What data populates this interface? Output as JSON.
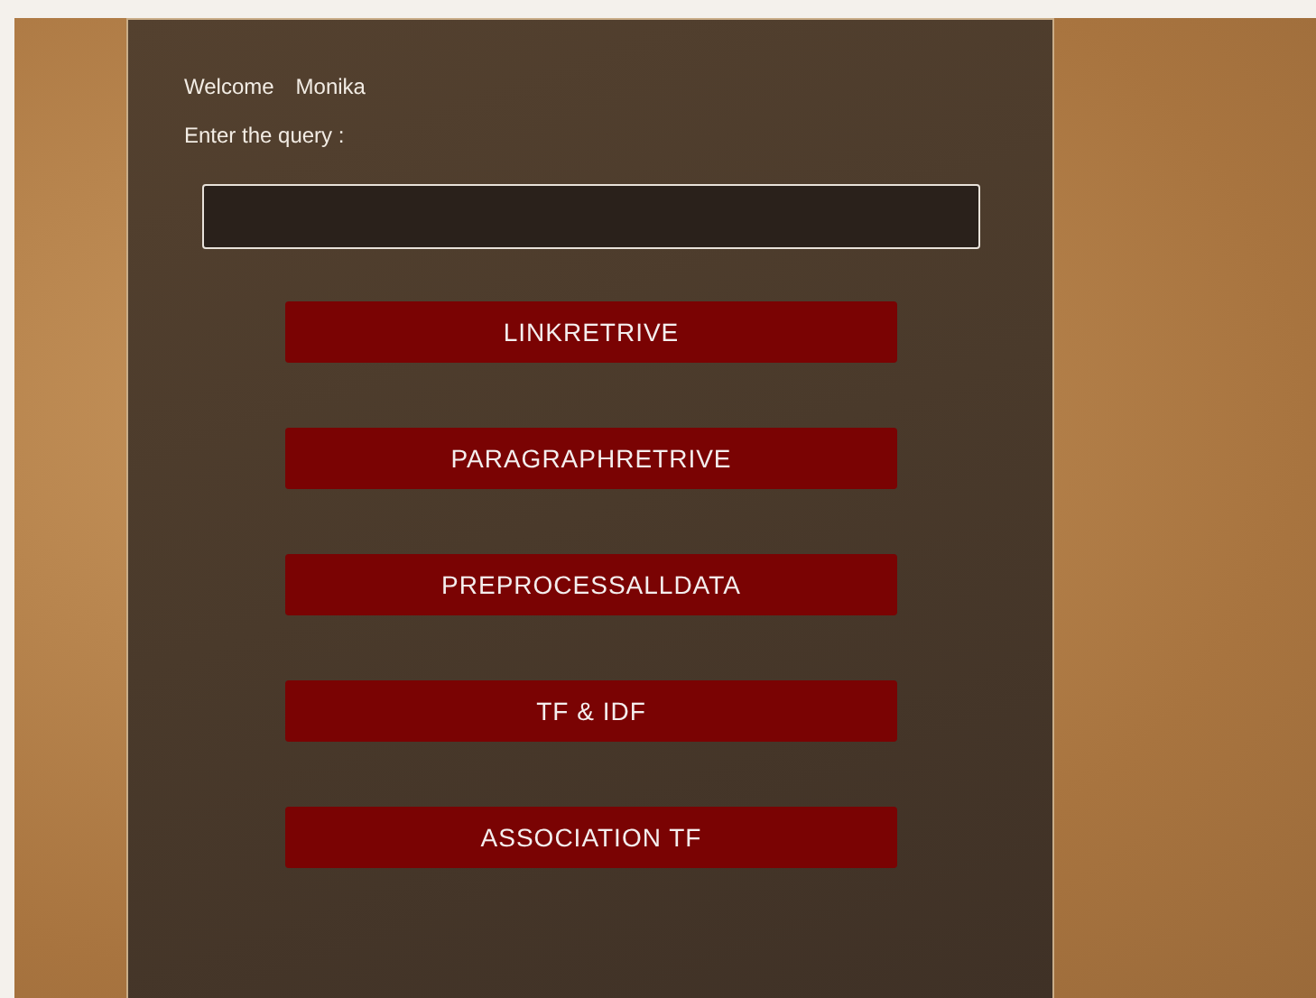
{
  "welcome": {
    "greeting": "Welcome",
    "user": "Monika"
  },
  "query_label": "Enter the query :",
  "buttons": [
    "LINKRETRIVE",
    "PARAGRAPHRETRIVE",
    "PREPROCESSALLDATA",
    "TF & IDF",
    "ASSOCIATION TF"
  ]
}
